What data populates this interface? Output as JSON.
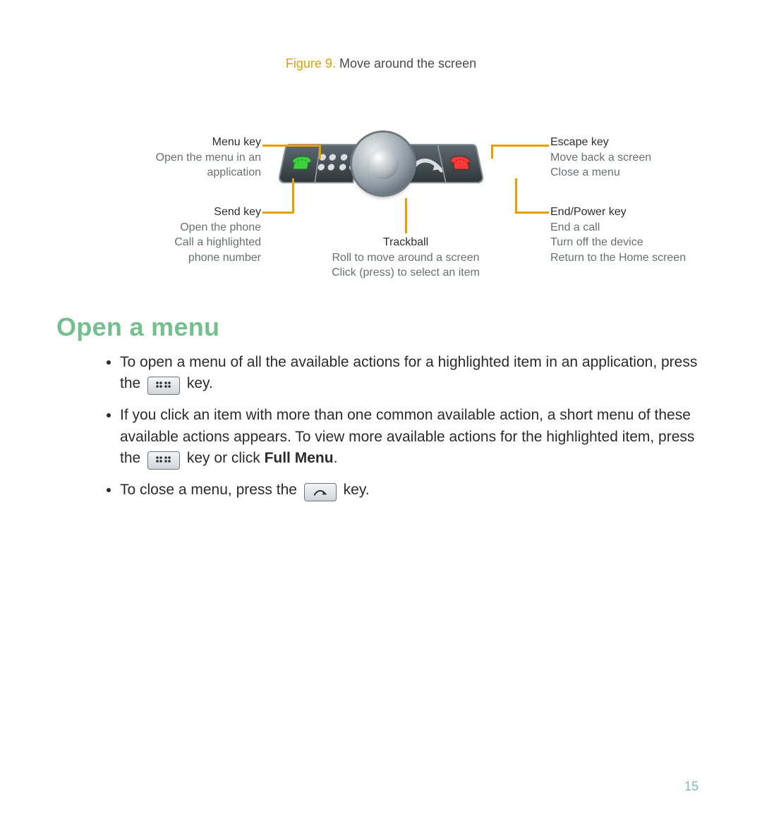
{
  "figure": {
    "num": "Figure 9.",
    "title": "Move around the screen"
  },
  "labels": {
    "menu": {
      "title": "Menu key",
      "lines": [
        "Open the menu in an",
        "application"
      ]
    },
    "send": {
      "title": "Send key",
      "lines": [
        "Open the phone",
        "Call a highlighted",
        "phone number"
      ]
    },
    "esc": {
      "title": "Escape key",
      "lines": [
        "Move back a screen",
        "Close a menu"
      ]
    },
    "end": {
      "title": "End/Power key",
      "lines": [
        "End a call",
        "Turn off the device",
        "Return to the Home screen"
      ]
    },
    "tb": {
      "title": "Trackball",
      "lines": [
        "Roll to move around a screen",
        "Click (press) to select an item"
      ]
    }
  },
  "section_heading": "Open a menu",
  "bullets": {
    "b1a": "To open a menu of all the available actions for a highlighted item in an application, press the ",
    "b1b": " key.",
    "b2a": "If you click an item with more than one common available action, a short menu of these available actions appears. To view more available actions for the highlighted item, press the ",
    "b2b": " key or click ",
    "b2c": "Full Menu",
    "b2d": ".",
    "b3a": "To close a menu, press the ",
    "b3b": " key."
  },
  "page_number": "15"
}
